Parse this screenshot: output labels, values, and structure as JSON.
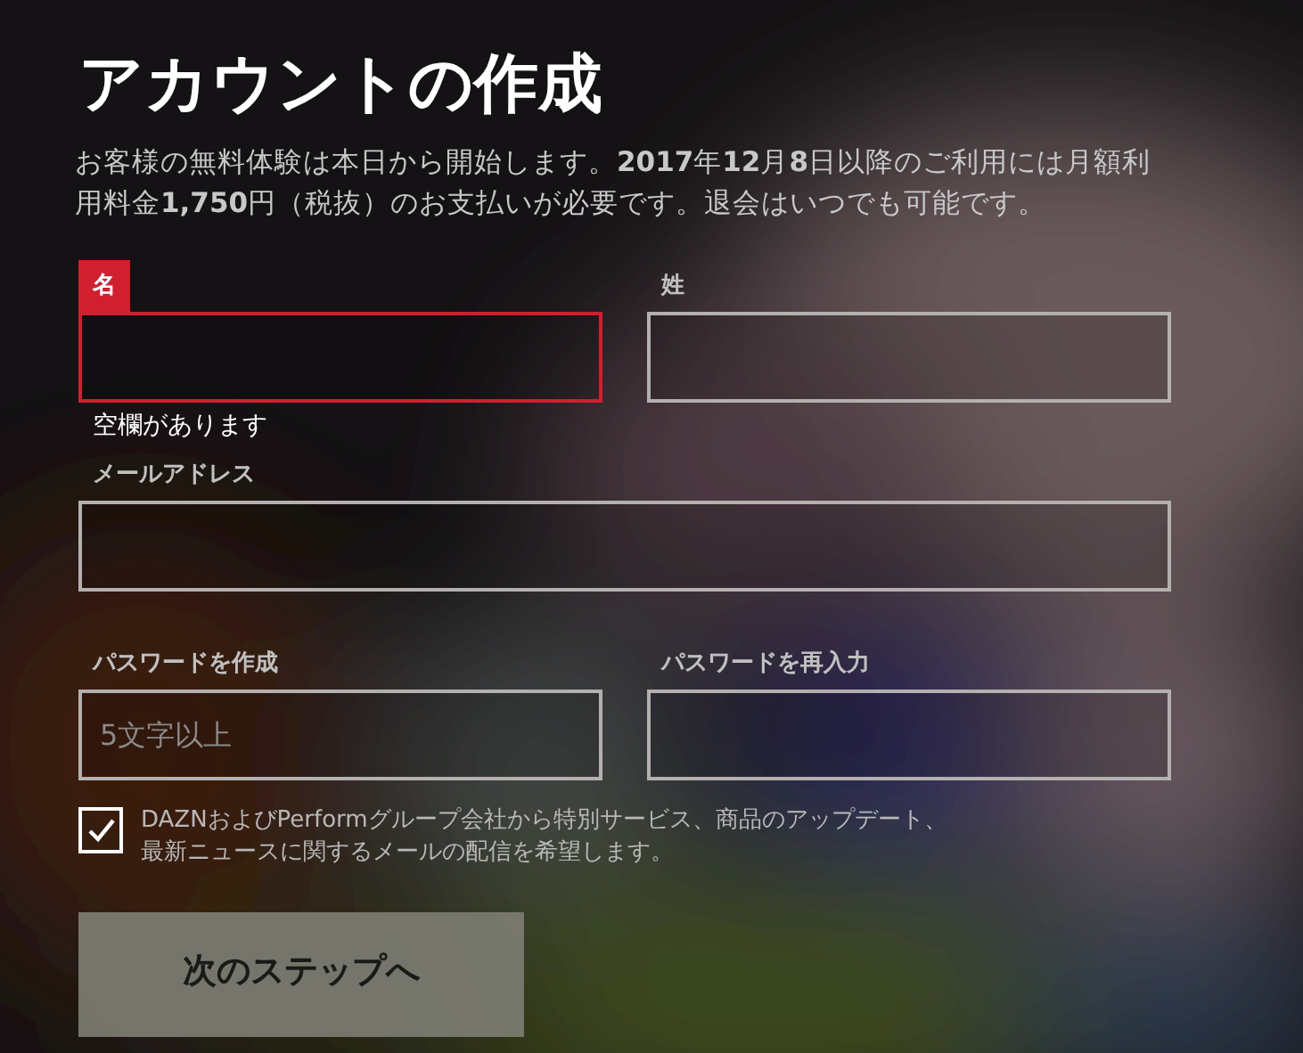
{
  "title": "アカウントの作成",
  "description": "お客様の無料体験は本日から開始します。**2017**年**12**月**8**日以降のご利用には月額利用料金**1,750**円（税抜）のお支払いが必要です。退会はいつでも可能です。",
  "fields": [
    {
      "label": "名",
      "kind": "half",
      "error": true,
      "error_message": "空欄があります"
    },
    {
      "label": "姓",
      "kind": "half",
      "error": false
    },
    {
      "label": "メールアドレス",
      "kind": "full",
      "error": false
    },
    {
      "label": "パスワードを作成",
      "kind": "half",
      "error": false,
      "placeholder": "5文字以上"
    },
    {
      "label": "パスワードを再入力",
      "kind": "half",
      "error": false
    }
  ],
  "consent": {
    "checked": true,
    "lines": [
      "DAZNおよびPerformグループ会社から特別サービス、商品のアップデート、",
      "最新ニュースに関するメールの配信を希望します。"
    ]
  },
  "next_button": "次のステップへ"
}
